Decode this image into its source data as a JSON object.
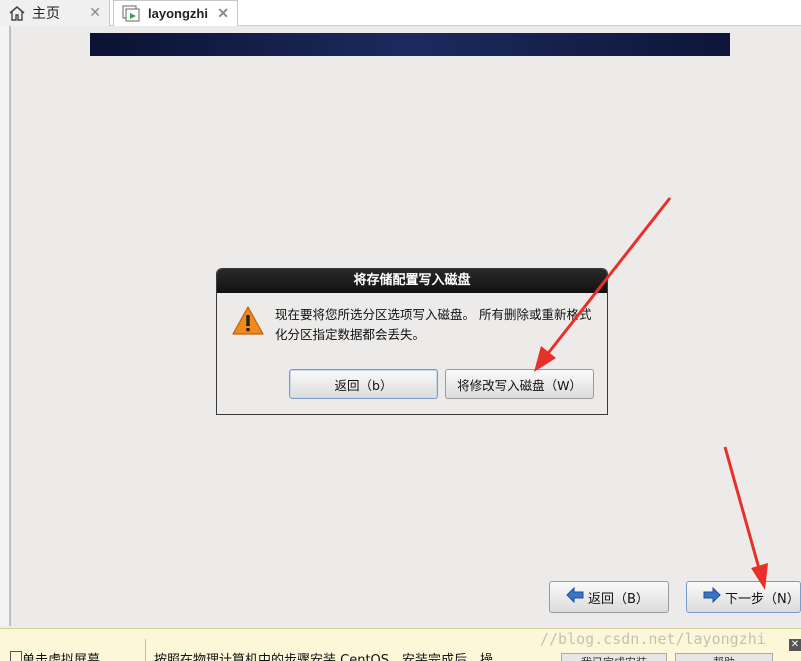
{
  "tabs": [
    {
      "label": "主页",
      "icon": "home-icon",
      "close": "✕"
    },
    {
      "label": "layongzhi",
      "icon": "vm-icon",
      "close": "✕"
    }
  ],
  "dialog": {
    "title": "将存储配置写入磁盘",
    "message": "现在要将您所选分区选项写入磁盘。 所有删除或重新格式化分区指定数据都会丢失。",
    "back_label": "返回（b）",
    "write_label": "将修改写入磁盘（W）"
  },
  "nav": {
    "prev_label": "返回（B）",
    "next_label": "下一步（N）"
  },
  "hint": {
    "left_text": "单击虚拟屏幕",
    "main_text": "按照在物理计算机中的步骤安装 CentOS。安装完成后，操",
    "done_label": "我已完成安装",
    "help_label": "帮助",
    "close": "✕"
  },
  "watermark": "//blog.csdn.net/layongzhi",
  "colors": {
    "arrow": "#e8302a",
    "banner": "#0f1a45",
    "warning": "#f08a1c"
  }
}
